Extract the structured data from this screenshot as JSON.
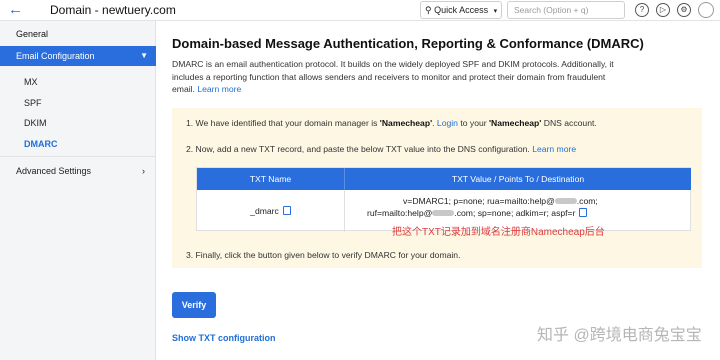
{
  "header": {
    "back_icon": "arrow-left-icon",
    "title": "Domain - newtuery.com",
    "quick_access": "Quick Access",
    "search_placeholder": "Search (Option + q)",
    "icons": [
      "help-icon",
      "megaphone-icon",
      "gear-icon",
      "avatar"
    ]
  },
  "sidebar": {
    "general": "General",
    "email_configuration": "Email Configuration",
    "sub_items": [
      "MX",
      "SPF",
      "DKIM",
      "DMARC"
    ],
    "active_item": "DMARC",
    "advanced_settings": "Advanced Settings"
  },
  "main": {
    "title": "Domain-based Message Authentication, Reporting & Conformance (DMARC)",
    "description": "DMARC is an email authentication protocol. It builds on the widely deployed SPF and DKIM protocols. Additionally, it includes a reporting function that allows senders and receivers to monitor and protect their domain from fraudulent email.",
    "learn_more": "Learn more",
    "steps": {
      "step1_prefix": "1. We have identified that your domain manager is ",
      "step1_provider": "'Namecheap'",
      "step1_dot": ". ",
      "step1_login": "Login",
      "step1_to": " to your ",
      "step1_provider2": "'Namecheap'",
      "step1_suffix": " DNS account.",
      "step2_text": "2. Now, add a new TXT record, and paste the below TXT value into the DNS configuration.",
      "step2_link": "Learn more",
      "step3_text": "3. Finally, click the button given below to verify DMARC for your domain."
    },
    "table": {
      "col1": "TXT Name",
      "col2": "TXT Value / Points To / Destination",
      "name": "_dmarc",
      "value_line1_a": "v=DMARC1; p=none; rua=mailto:help@",
      "value_line1_b": ".com;",
      "value_line2_a": "ruf=mailto:help@",
      "value_line2_b": ".com; sp=none; adkim=r; aspf=r"
    },
    "annotation": "把这个TXT记录加到域名注册商Namecheap后台",
    "verify_button": "Verify",
    "show_txt": "Show TXT configuration"
  },
  "watermark": "知乎 @跨境电商兔宝宝",
  "colors": {
    "accent": "#2a6ede",
    "link": "#1f6fd6",
    "box": "#fdf7e4",
    "annotation": "#e23a3a"
  }
}
